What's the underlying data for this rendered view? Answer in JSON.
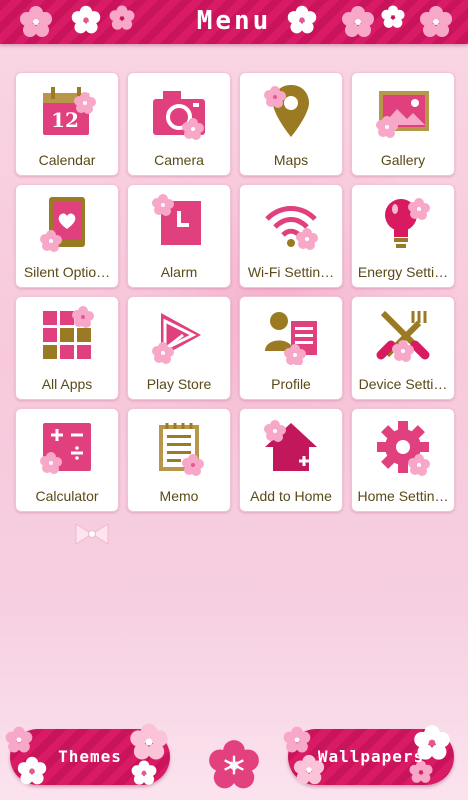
{
  "header": {
    "title": "Menu"
  },
  "apps": [
    {
      "label": "Calendar",
      "icon": "calendar-icon",
      "day": "12"
    },
    {
      "label": "Camera",
      "icon": "camera-icon"
    },
    {
      "label": "Maps",
      "icon": "map-pin-icon"
    },
    {
      "label": "Gallery",
      "icon": "gallery-icon"
    },
    {
      "label": "Silent Optio…",
      "icon": "tablet-heart-icon"
    },
    {
      "label": "Alarm",
      "icon": "alarm-icon"
    },
    {
      "label": "Wi-Fi Settin…",
      "icon": "wifi-icon"
    },
    {
      "label": "Energy Setti…",
      "icon": "lightbulb-icon"
    },
    {
      "label": "All Apps",
      "icon": "grid-icon"
    },
    {
      "label": "Play Store",
      "icon": "play-store-icon"
    },
    {
      "label": "Profile",
      "icon": "profile-card-icon"
    },
    {
      "label": "Device Setti…",
      "icon": "tools-icon"
    },
    {
      "label": "Calculator",
      "icon": "calculator-icon"
    },
    {
      "label": "Memo",
      "icon": "memo-icon"
    },
    {
      "label": "Add to Home",
      "icon": "add-home-icon"
    },
    {
      "label": "Home Settin…",
      "icon": "gear-icon"
    }
  ],
  "bottom": {
    "themes_label": "Themes",
    "wallpapers_label": "Wallpapers"
  },
  "colors": {
    "accent": "#d91b66",
    "gold": "#9a7a22",
    "pink_light": "#f9d6e4",
    "label": "#5a4a18"
  }
}
